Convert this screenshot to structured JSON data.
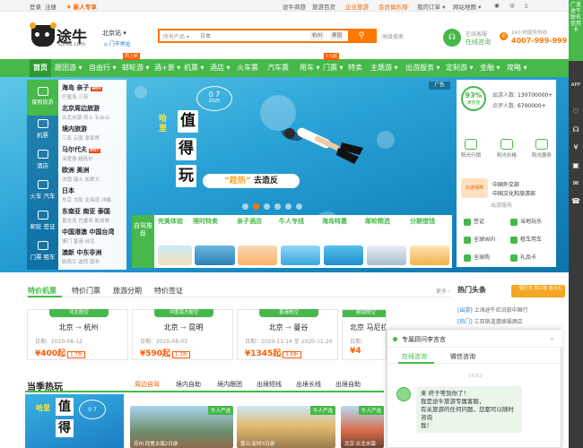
{
  "topbar": {
    "login": "登录",
    "register": "注册",
    "newbie": "新人专享",
    "links": [
      "途牛商旅",
      "旅游百货",
      "企业旅游",
      "会员俱乐部",
      "我的订单 ▾",
      "网站地图 ▾"
    ]
  },
  "header": {
    "logo_text": "途牛",
    "logo_sub": "tuniu.com",
    "city": "北京站 ▾",
    "city_sub": "门市地址",
    "search": {
      "category": "所有产品 ▾",
      "placeholder": "日本",
      "hot_tags": [
        "杭州",
        "泰国"
      ],
      "button_icon": "search-icon"
    },
    "advanced": "高级搜索",
    "service_label": "在线客服",
    "online_label": "在线咨询",
    "phone_label": "24小时服务热线",
    "phone": "4007-999-999"
  },
  "nav": {
    "items": [
      "首页",
      "跟团游 ▾",
      "自由行 ▾",
      "邮轮游 ▾",
      "酒+景 ▾",
      "机票 ▾",
      "酒店 ▾",
      "火车票",
      "汽车票",
      "用车 ▾",
      "门票 ▾",
      "特卖",
      "主题游 ▾",
      "出游服务 ▾",
      "定制游 ▾",
      "金融 ▾",
      "攻略 ▾"
    ],
    "tags": [
      {
        "index": 3,
        "text": "周上新"
      },
      {
        "index": 10,
        "text": "1元起"
      }
    ],
    "accent": "#47b84a"
  },
  "sidebar_right": {
    "top_text": "广发途牛联名信用卡",
    "app": "APP",
    "icons": [
      "heart-icon",
      "headset-icon",
      "coupon-icon",
      "gift-icon",
      "message-icon",
      "phone-icon"
    ]
  },
  "left_categories": [
    {
      "label": "度假旅游",
      "icon": "palm-icon"
    },
    {
      "label": "机票",
      "icon": "plane-icon"
    },
    {
      "label": "酒店",
      "icon": "hotel-icon"
    },
    {
      "label": "火车 汽车",
      "icon": "train-icon"
    },
    {
      "label": "邮轮 签证",
      "icon": "ship-icon"
    },
    {
      "label": "门票 租车",
      "icon": "ticket-icon"
    }
  ],
  "category_list": [
    {
      "title": "海岛 亲子",
      "hot": "HOT",
      "sub": "巴厘岛 三亚"
    },
    {
      "title": "北京周边旅游",
      "hot": "",
      "sub": "古北水镇 坝上 五台山"
    },
    {
      "title": "境内旅游",
      "hot": "",
      "sub": "三亚 云南 张家界"
    },
    {
      "title": "马尔代夫",
      "hot": "HOT",
      "sub": "深度游 超低价"
    },
    {
      "title": "欧洲 美洲",
      "hot": "",
      "sub": "法国 瑞士 加拿大"
    },
    {
      "title": "日本",
      "hot": "",
      "sub": "东京 大阪 北海道 冲绳"
    },
    {
      "title": "东南亚 南亚 泰国",
      "hot": "",
      "sub": "普吉岛 巴厘岛 新加坡"
    },
    {
      "title": "中国港澳 中国台湾",
      "hot": "",
      "sub": "澳门 香港 台北"
    },
    {
      "title": "澳新 中东非洲",
      "hot": "",
      "sub": "新西兰 迪拜 南非"
    }
  ],
  "banner": {
    "hali": "哈里",
    "words": [
      "值",
      "得",
      "玩"
    ],
    "date_top": "0 7",
    "date_bottom": "2020",
    "slogan_quoted": "“趁热”",
    "slogan_rest": " 去造反",
    "ad_mark": "广告",
    "slides": 6,
    "active_slide": 1
  },
  "right_panel": {
    "satisfaction": "93%",
    "satisfaction_label": "满意度",
    "stats": [
      {
        "label": "出游人数",
        "value": "130700000+"
      },
      {
        "label": "点评人数",
        "value": "6700000+"
      }
    ],
    "icons": [
      {
        "label": "阳光行销",
        "icon": "sun-icon"
      },
      {
        "label": "阳光价格",
        "icon": "price-icon"
      },
      {
        "label": "阳光服务",
        "icon": "service-icon"
      }
    ],
    "gov_line1": "中国外交部",
    "gov_line2": "中国文化和旅游部",
    "gov_badge": "出游保障",
    "bottom_header": "出游服务",
    "services": [
      "签证",
      "当地玩乐",
      "全球WiFi",
      "租车用车",
      "全球购",
      "礼品卡"
    ]
  },
  "promo": {
    "head": "自驾推荐",
    "items": [
      {
        "title": "完美体验",
        "sub": ""
      },
      {
        "title": "限时特卖",
        "sub": ""
      },
      {
        "title": "亲子酒店",
        "sub": ""
      },
      {
        "title": "牛人专线",
        "sub": ""
      },
      {
        "title": "海岛特惠",
        "sub": ""
      },
      {
        "title": "邮轮精选",
        "sub": ""
      },
      {
        "title": "分期借钱",
        "sub": ""
      }
    ]
  },
  "special_tabs": [
    "特价机票",
    "特价门票",
    "旅游分期",
    "特价签证"
  ],
  "more": "更多 ›",
  "flights": [
    {
      "airline": "河北航空",
      "from": "北京",
      "to": "杭州",
      "date": "日期：2020-08-12",
      "price": "¥400起",
      "disc": "1.7折"
    },
    {
      "airline": "中国南方航空",
      "from": "北京",
      "to": "昆明",
      "date": "日期：2020-08-03",
      "price": "¥590起",
      "disc": "1.3折"
    },
    {
      "airline": "香港航空",
      "from": "北京",
      "to": "曼谷",
      "date": "日期：2020-11-14 至 2020-11-20",
      "price": "¥1345起",
      "disc": "1.6折"
    },
    {
      "airline": "越南航空",
      "from": "北京",
      "to": "马尼拉",
      "date": "日期：",
      "price": "¥4",
      "disc": ""
    }
  ],
  "headlines": {
    "title": "热门头条",
    "banner": "银行日 周三签 有大礼",
    "items": [
      {
        "tag": "[出游]",
        "text": "上海途牛尼泊旅中国行"
      },
      {
        "tag": "[热门]",
        "text": "三亚斯道遗德福酒店"
      }
    ]
  },
  "hot_section": {
    "title": "当季热玩",
    "tabs": [
      "周边自驾",
      "境内自助",
      "境内跟团",
      "出境短线",
      "出境长线",
      "出境自助"
    ],
    "cards": [
      {
        "badge": "牛人严选",
        "caption": "苏州·同里古镇2日游"
      },
      {
        "badge": "牛人严选",
        "caption": "黄山·宏村3日游"
      },
      {
        "badge": "牛人严选",
        "caption": "北京·古北水镇"
      }
    ]
  },
  "chat": {
    "title": "专属顾问李言言",
    "tabs": [
      "在线咨询",
      "微信咨询"
    ],
    "time": "14:52",
    "message_lines": [
      "来 终于等到你了！",
      "我是途牛旅游专属客服，",
      "有关旅游的任何问题，您都可以随时咨询",
      "我！"
    ]
  }
}
